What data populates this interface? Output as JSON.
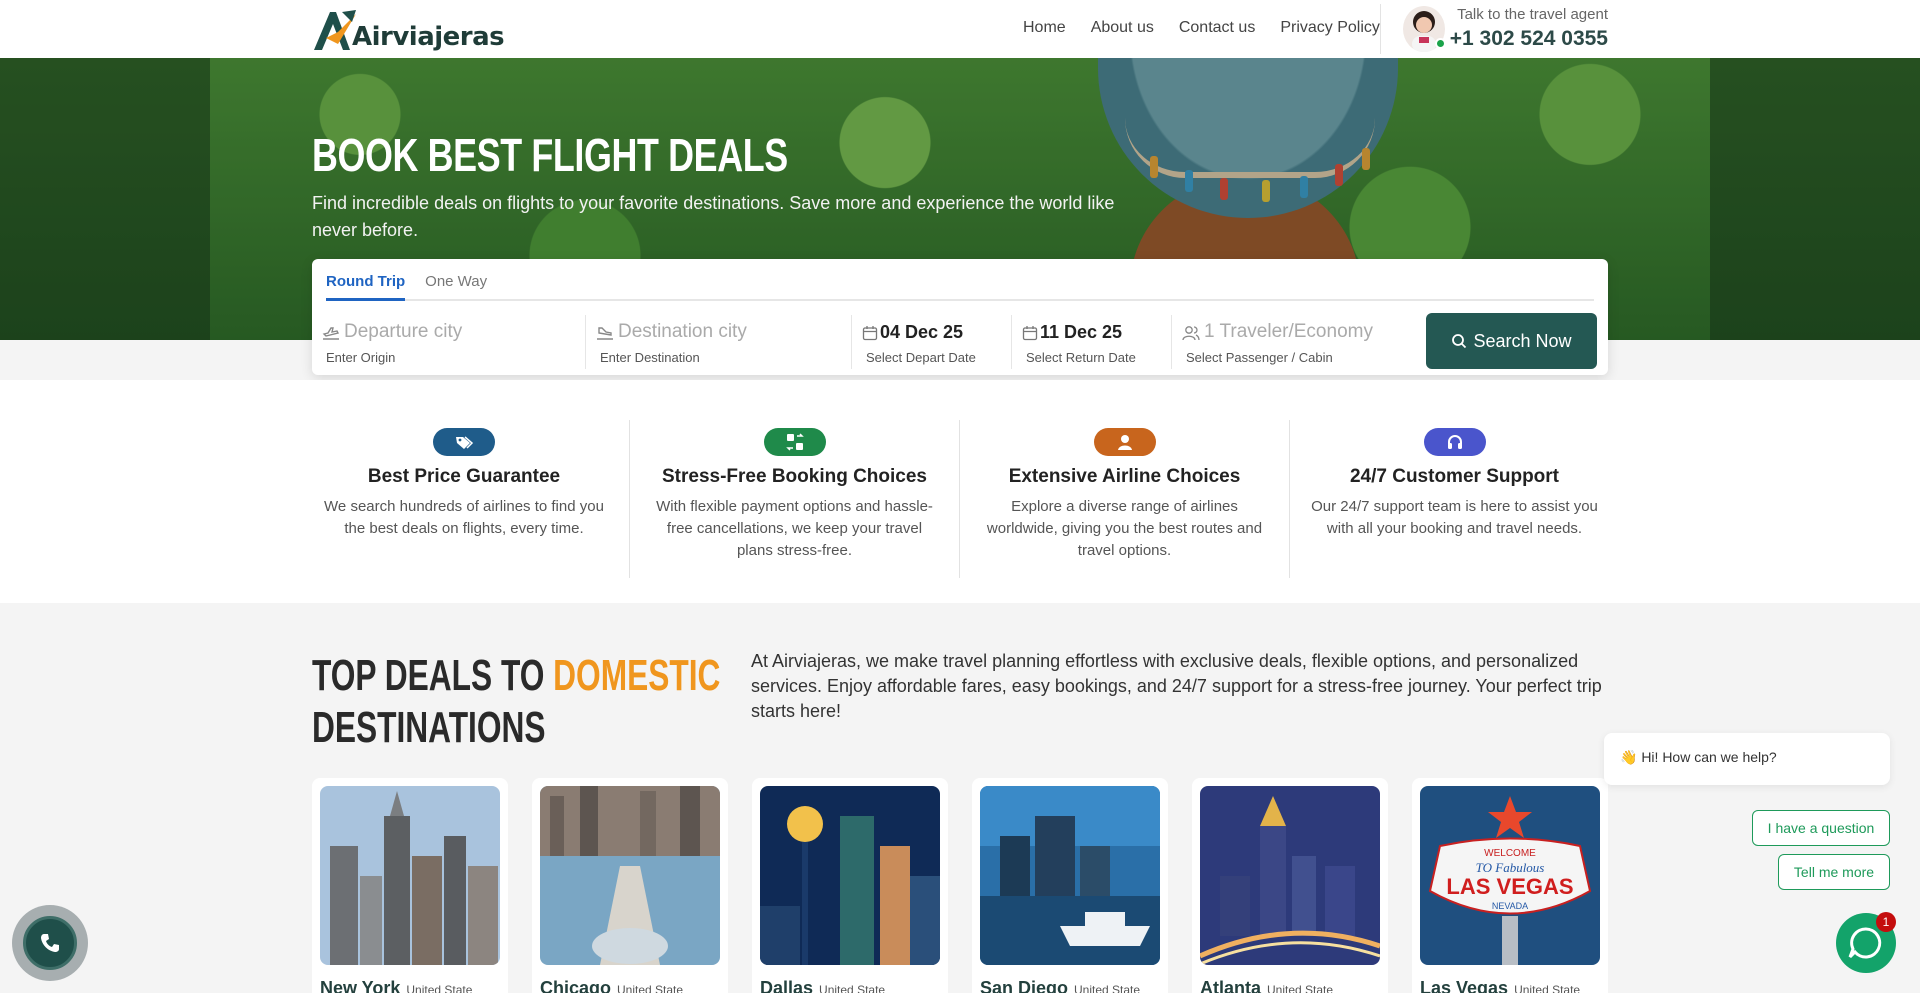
{
  "brand": {
    "name": "Airviajeras"
  },
  "nav": {
    "items": [
      "Home",
      "About us",
      "Contact us",
      "Privacy Policy"
    ]
  },
  "agent": {
    "label": "Talk to the travel agent",
    "phone": "+1 302 524 0355"
  },
  "hero": {
    "title": "BOOK BEST FLIGHT DEALS",
    "subtitle": "Find incredible deals on flights to your favorite destinations. Save more and experience the world like never before."
  },
  "search": {
    "tabs": [
      "Round Trip",
      "One Way"
    ],
    "active_tab": "Round Trip",
    "fields": [
      {
        "value": "Departure city",
        "hint": "Enter Origin",
        "placeholder": true
      },
      {
        "value": "Destination city",
        "hint": "Enter Destination",
        "placeholder": true
      },
      {
        "value": "04 Dec 25",
        "hint": "Select Depart Date",
        "placeholder": false
      },
      {
        "value": "11 Dec 25",
        "hint": "Select Return Date",
        "placeholder": false
      },
      {
        "value": "1 Traveler/Economy",
        "hint": "Select Passenger / Cabin",
        "placeholder": true
      }
    ],
    "button": "Search Now"
  },
  "features": [
    {
      "title": "Best Price Guarantee",
      "desc": "We search hundreds of airlines to find you the best deals on flights, every time.",
      "color": "#1f5c8a",
      "icon": "tags-icon"
    },
    {
      "title": "Stress-Free Booking Choices",
      "desc": "With flexible payment options and hassle-free cancellations, we keep your travel plans stress-free.",
      "color": "#1f8a4a",
      "icon": "exchange-icon"
    },
    {
      "title": "Extensive Airline Choices",
      "desc": "Explore a diverse range of airlines worldwide, giving you the best routes and travel options.",
      "color": "#c8651d",
      "icon": "user-shield-icon"
    },
    {
      "title": "24/7 Customer Support",
      "desc": "Our 24/7 support team is here to assist you with all your booking and travel needs.",
      "color": "#4a55cc",
      "icon": "headset-icon"
    }
  ],
  "deals": {
    "title_part1": "TOP DEALS TO ",
    "title_accent": "DOMESTIC",
    "title_part2": "DESTINATIONS",
    "text": "At Airviajeras, we make travel planning effortless with exclusive deals, flexible options, and personalized services. Enjoy affordable fares, easy bookings, and 24/7 support for a stress-free journey. Your perfect trip starts here!",
    "cities": [
      {
        "city": "New York",
        "country": "United State"
      },
      {
        "city": "Chicago",
        "country": "United State"
      },
      {
        "city": "Dallas",
        "country": "United State"
      },
      {
        "city": "San Diego",
        "country": "United State"
      },
      {
        "city": "Atlanta",
        "country": "United State"
      },
      {
        "city": "Las Vegas",
        "country": "United State"
      }
    ],
    "vegas_sign": {
      "line1": "WELCOME",
      "line2": "TO Fabulous",
      "line3": "LAS VEGAS",
      "line4": "NEVADA"
    }
  },
  "chat": {
    "greeting": "👋 Hi! How can we help?",
    "option1": "I have a question",
    "option2": "Tell me more",
    "unread": "1"
  },
  "colors": {
    "brand_dark": "#245853",
    "accent": "#f0961e",
    "link": "#1f64c2"
  }
}
